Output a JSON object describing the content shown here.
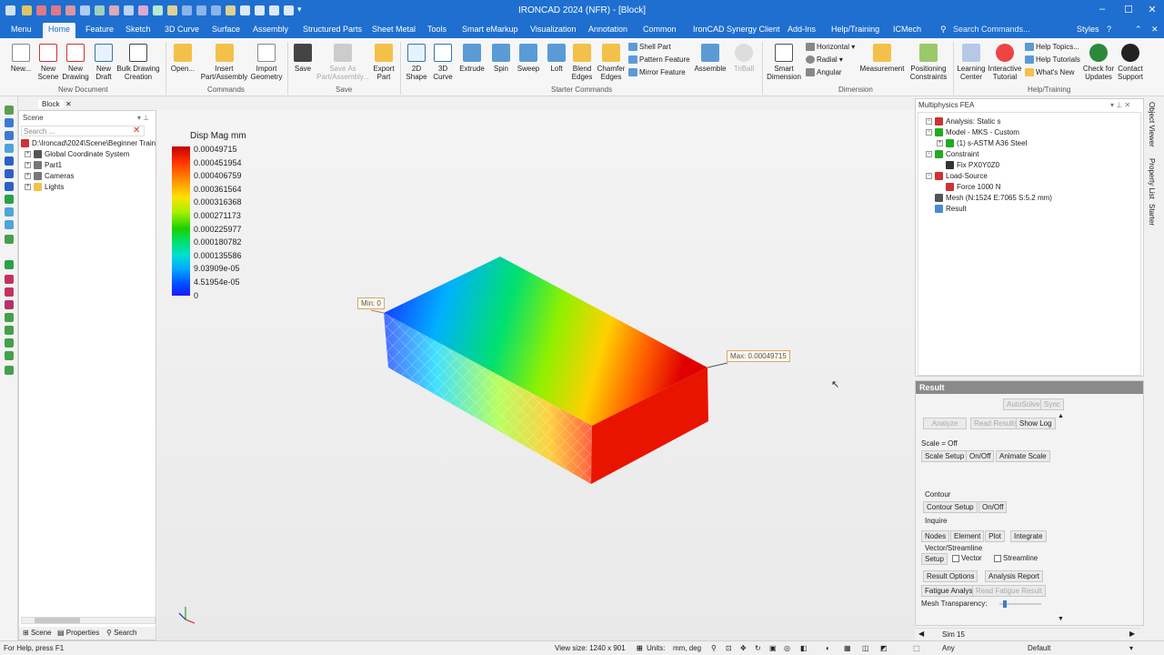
{
  "window": {
    "title": "IRONCAD 2024 (NFR) - [Block]"
  },
  "menu": {
    "items": [
      "Menu",
      "Home",
      "Feature",
      "Sketch",
      "3D Curve",
      "Surface",
      "Assembly",
      "Structured Parts",
      "Sheet Metal",
      "Tools",
      "Smart eMarkup",
      "Visualization",
      "Annotation",
      "Common",
      "IronCAD Synergy Client",
      "Add-Ins",
      "Help/Training",
      "ICMech"
    ],
    "styles": "Styles",
    "search_placeholder": "Search Commands..."
  },
  "ribbon": {
    "new": "New...",
    "new_scene": "New\nScene",
    "new_drawing": "New\nDrawing",
    "new_draft": "New\nDraft",
    "bulk_drawing": "Bulk Drawing\nCreation",
    "open": "Open...",
    "insert": "Insert\nPart/Assembly",
    "import": "Import\nGeometry",
    "save": "Save",
    "save_as": "Save As\nPart/Assembly...",
    "export": "Export\nPart",
    "shape_2d": "2D\nShape",
    "curve_3d": "3D\nCurve",
    "extrude": "Extrude",
    "spin": "Spin",
    "sweep": "Sweep",
    "loft": "Loft",
    "blend": "Blend\nEdges",
    "chamfer": "Chamfer\nEdges",
    "shell": "Shell Part",
    "pattern": "Pattern Feature",
    "mirror": "Mirror Feature",
    "assemble": "Assemble",
    "triball": "TriBall",
    "smart_dim": "Smart\nDimension",
    "horizontal": "Horizontal",
    "radial": "Radial",
    "angular": "Angular",
    "measurement": "Measurement",
    "positioning": "Positioning\nConstraints",
    "learning": "Learning\nCenter",
    "interactive": "Interactive\nTutorial",
    "help_topics": "Help Topics...",
    "help_tutorials": "Help Tutorials",
    "whats_new": "What's New",
    "check_updates": "Check for\nUpdates",
    "contact": "Contact\nSupport",
    "groups": {
      "new_doc": "New Document",
      "commands": "Commands",
      "save": "Save",
      "starter": "Starter Commands",
      "dimension": "Dimension",
      "help": "Help/Training"
    }
  },
  "scene": {
    "doc_tab": "Block",
    "title": "Scene",
    "search_placeholder": "Search ...",
    "items": [
      "D:\\Ironcad\\2024\\Scene\\Beginner Train",
      "Global Coordinate System",
      "Part1",
      "Cameras",
      "Lights"
    ],
    "bottom_tabs": [
      "Scene",
      "Properties",
      "Search"
    ]
  },
  "legend": {
    "title": "Disp Mag mm",
    "values": [
      "0.00049715",
      "0.000451954",
      "0.000406759",
      "0.000361564",
      "0.000316368",
      "0.000271173",
      "0.000225977",
      "0.000180782",
      "0.000135586",
      "9.03909e-05",
      "4.51954e-05",
      "0"
    ],
    "min_tag": "Min: 0",
    "max_tag": "Max: 0.00049715"
  },
  "fea": {
    "title": "Multiphysics FEA",
    "items": [
      "Analysis: Static s",
      "Model - MKS - Custom",
      "(1) s-ASTM A36 Steel",
      "Constraint",
      "Fix PX0Y0Z0",
      "Load-Source",
      "Force 1000 N",
      "Mesh (N:1524 E:7065 S:5.2 mm)",
      "Result"
    ]
  },
  "result": {
    "title": "Result",
    "autosolve": "AutoSolve",
    "sync": "Sync",
    "analyze": "Analyze",
    "read_results": "Read Results",
    "show_log": "Show Log",
    "scale": "Scale = Off",
    "scale_setup": "Scale Setup",
    "onoff": "On/Off",
    "animate": "Animate Scale",
    "contour": "Contour",
    "contour_setup": "Contour Setup",
    "contour_onoff": "On/Off",
    "inquire": "Inquire",
    "nodes": "Nodes",
    "element": "Element",
    "plot": "Plot",
    "integrate": "Integrate",
    "vector_streamline": "Vector/Streamline",
    "setup": "Setup",
    "vector": "Vector",
    "streamline": "Streamline",
    "result_options": "Result Options",
    "analysis_report": "Analysis Report",
    "fatigue": "Fatigue Analysis",
    "read_fatigue": "Read Fatigue Result",
    "mesh_transparency": "Mesh Transparency:",
    "sim_tab": "Sim 15"
  },
  "right_tabs": [
    "Object Viewer",
    "Property List",
    "Starter"
  ],
  "status": {
    "help": "For Help, press F1",
    "view_size": "View size: 1240 x 901",
    "units_label": "Units:",
    "units": "mm, deg",
    "any": "Any",
    "default": "Default"
  },
  "colors": {
    "accent": "#1e6fd0",
    "panel_header": "#8a8a8a"
  }
}
